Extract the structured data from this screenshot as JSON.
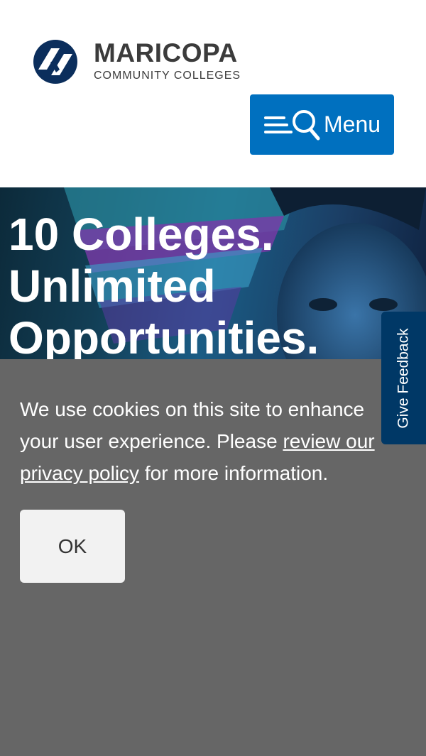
{
  "header": {
    "logo": {
      "name": "MARICOPA",
      "subtitle": "COMMUNITY COLLEGES",
      "icon": "maricopa-logo-mark"
    },
    "menu_button": {
      "label": "Menu",
      "icons": [
        "hamburger-icon",
        "search-icon"
      ]
    }
  },
  "hero": {
    "title_lines": [
      "10 Colleges.",
      "Unlimited",
      "Opportunities."
    ]
  },
  "cookie_banner": {
    "text_before": "We use cookies on this site to enhance your user experience. Please ",
    "link_text": "review our privacy policy",
    "text_after": " for more information.",
    "ok_label": "OK"
  },
  "feedback_tab": {
    "label": "Give Feedback"
  },
  "colors": {
    "brand_blue": "#0070bf",
    "navy": "#003866",
    "logo_navy": "#0b2e5c",
    "banner_gray": "#666666"
  }
}
